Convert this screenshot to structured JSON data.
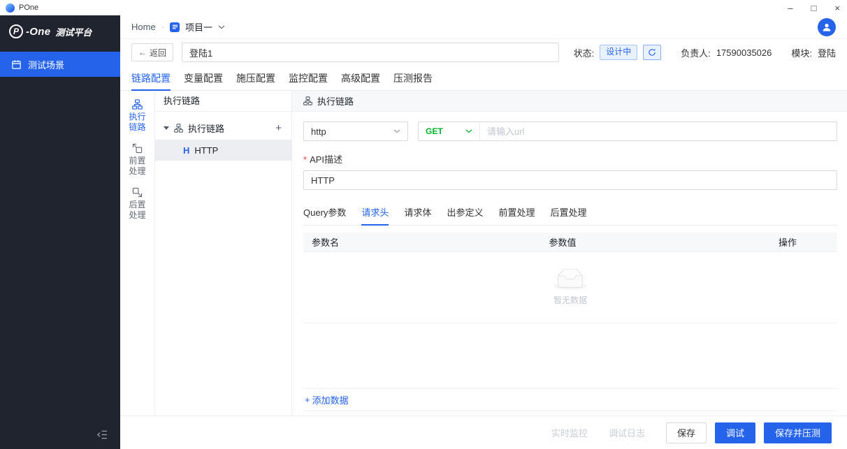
{
  "window": {
    "title": "POne",
    "controls": {
      "minimize": "–",
      "maximize": "□",
      "close": "×"
    }
  },
  "sidebar": {
    "logo": {
      "badge": "P",
      "name": "-One",
      "suffix": "测试平台"
    },
    "items": [
      {
        "label": "测试场景"
      }
    ]
  },
  "topbar": {
    "home": "Home",
    "separator": "·",
    "project": "项目一"
  },
  "toolbar": {
    "back_arrow": "←",
    "back_label": "返回",
    "scene_name": "登陆1",
    "status_label": "状态:",
    "status_value": "设计中",
    "owner_label": "负责人:",
    "owner_value": "17590035026",
    "module_label": "模块:",
    "module_value": "登陆"
  },
  "main_tabs": [
    "链路配置",
    "变量配置",
    "施压配置",
    "监控配置",
    "高级配置",
    "压测报告"
  ],
  "rail": [
    "执行链路",
    "前置处理",
    "后置处理"
  ],
  "tree": {
    "header": "执行链路",
    "root_label": "执行链路",
    "add": "+",
    "child": {
      "icon": "H",
      "label": "HTTP"
    }
  },
  "panel": {
    "header": "执行链路",
    "protocol": "http",
    "method": "GET",
    "url_placeholder": "请输入url",
    "required_mark": "*",
    "api_desc_label": "API描述",
    "api_desc_value": "HTTP",
    "sub_tabs": [
      "Query参数",
      "请求头",
      "请求体",
      "出参定义",
      "前置处理",
      "后置处理"
    ],
    "table": {
      "headers": [
        "参数名",
        "参数值",
        "操作"
      ],
      "empty_text": "暂无数据",
      "add_icon": "+",
      "add_label": "添加数据"
    }
  },
  "footer": {
    "monitor": "实时监控",
    "debug_log": "调试日志",
    "save": "保存",
    "debug": "调试",
    "save_and_test": "保存并压测"
  },
  "colors": {
    "accent": "#2563eb",
    "method_green": "#00b42a",
    "sidebar_bg": "#20242f",
    "danger": "#f53f3f"
  }
}
